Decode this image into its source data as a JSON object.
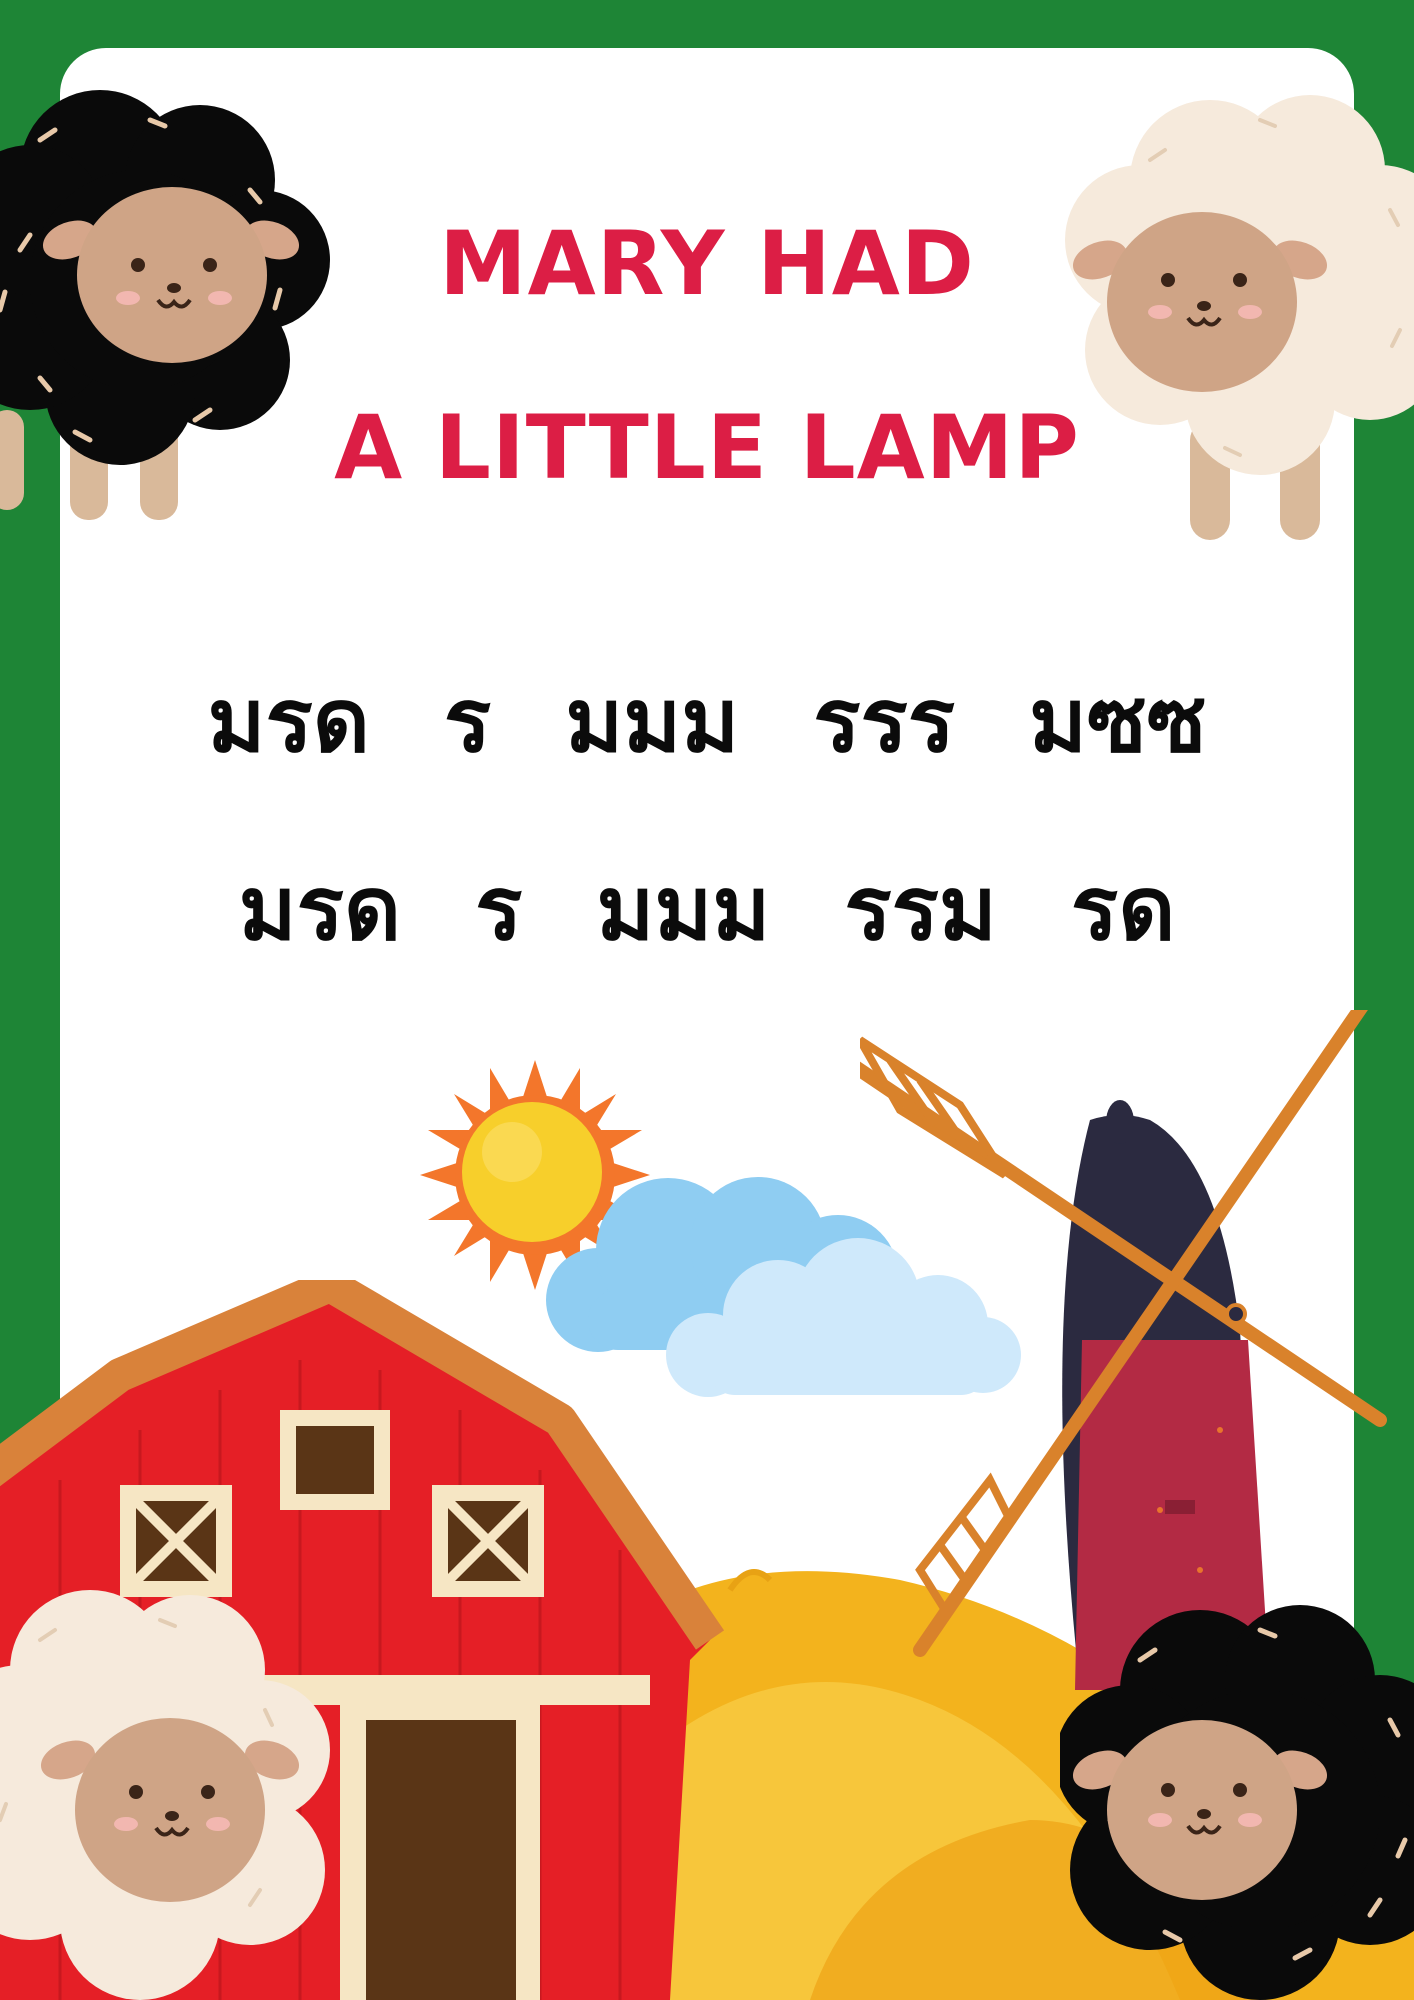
{
  "title": {
    "line1": "MARY HAD",
    "line2": "A LITTLE LAMP"
  },
  "notes": {
    "line1": [
      "มรด",
      "ร",
      "มมม",
      "รรร",
      "มซซ"
    ],
    "line2": [
      "มรด",
      "ร",
      "มมม",
      "รรม",
      "รด"
    ]
  },
  "colors": {
    "frame": "#1e8536",
    "title": "#dc1e45",
    "barn_red": "#e51f26",
    "barn_roof": "#d9823a",
    "sun": "#f7cf2b",
    "sun_rays": "#f3762b",
    "cloud": "#8fcdf2",
    "windmill_top": "#2b2a40",
    "windmill_body": "#b32a44",
    "windmill_sails": "#d9822b",
    "hill": "#f3b31d",
    "sheep_black": "#0a0a0a",
    "sheep_cream": "#f6eadc",
    "sheep_face": "#cfa486"
  },
  "icons": [
    "sheep-black-icon",
    "sheep-cream-icon",
    "sun-icon",
    "cloud-icon",
    "windmill-icon",
    "barn-icon",
    "hill-icon"
  ]
}
